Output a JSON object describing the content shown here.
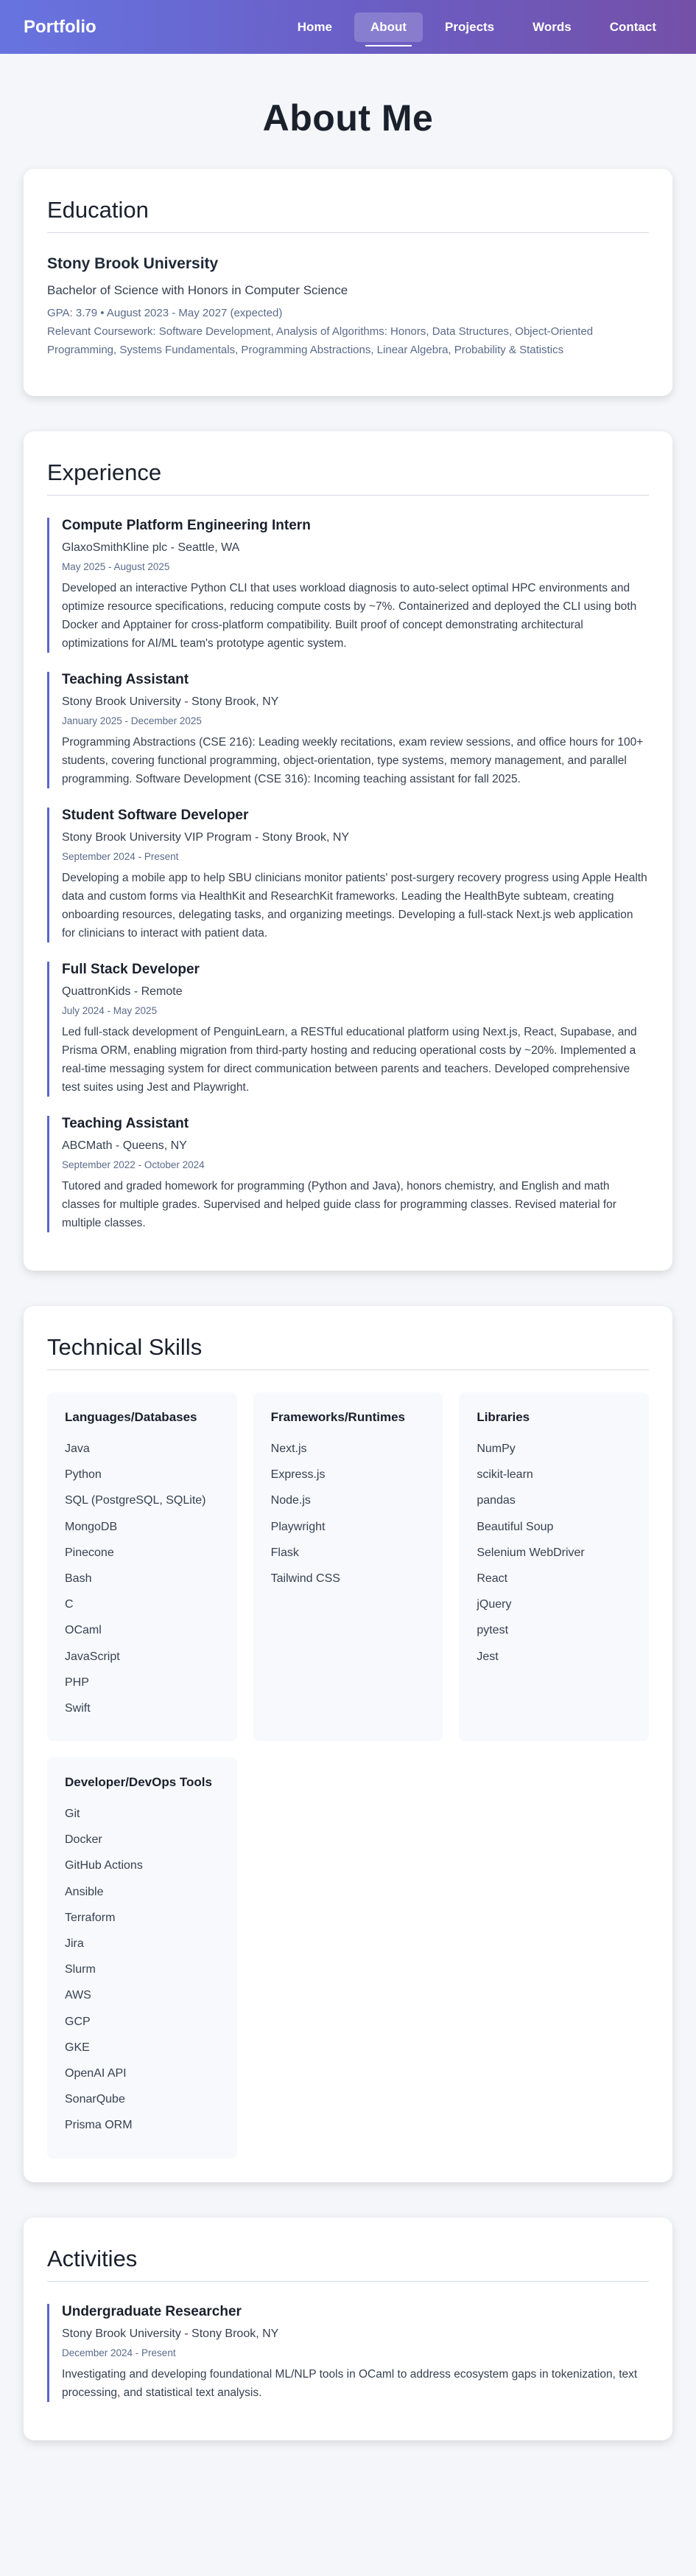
{
  "nav": {
    "brand": "Portfolio",
    "links": [
      "Home",
      "About",
      "Projects",
      "Words",
      "Contact"
    ]
  },
  "page_title": "About Me",
  "education": {
    "title": "Education",
    "school": "Stony Brook University",
    "degree": "Bachelor of Science with Honors in Computer Science",
    "meta": "GPA: 3.79 • August 2023 - May 2027 (expected)",
    "coursework": "Relevant Coursework: Software Development, Analysis of Algorithms: Honors, Data Structures, Object-Oriented Programming, Systems Fundamentals, Programming Abstractions, Linear Algebra, Probability & Statistics"
  },
  "experience": {
    "title": "Experience",
    "entries": [
      {
        "title": "Compute Platform Engineering Intern",
        "org": "GlaxoSmithKline plc - Seattle, WA",
        "date": "May 2025 - August 2025",
        "desc": "Developed an interactive Python CLI that uses workload diagnosis to auto-select optimal HPC environments and optimize resource specifications, reducing compute costs by ~7%. Containerized and deployed the CLI using both Docker and Apptainer for cross-platform compatibility. Built proof of concept demonstrating architectural optimizations for AI/ML team's prototype agentic system."
      },
      {
        "title": "Teaching Assistant",
        "org": "Stony Brook University - Stony Brook, NY",
        "date": "January 2025 - December 2025",
        "desc": "Programming Abstractions (CSE 216): Leading weekly recitations, exam review sessions, and office hours for 100+ students, covering functional programming, object-orientation, type systems, memory management, and parallel programming. Software Development (CSE 316): Incoming teaching assistant for fall 2025."
      },
      {
        "title": "Student Software Developer",
        "org": "Stony Brook University VIP Program - Stony Brook, NY",
        "date": "September 2024 - Present",
        "desc": "Developing a mobile app to help SBU clinicians monitor patients' post-surgery recovery progress using Apple Health data and custom forms via HealthKit and ResearchKit frameworks. Leading the HealthByte subteam, creating onboarding resources, delegating tasks, and organizing meetings. Developing a full-stack Next.js web application for clinicians to interact with patient data."
      },
      {
        "title": "Full Stack Developer",
        "org": "QuattronKids - Remote",
        "date": "July 2024 - May 2025",
        "desc": "Led full-stack development of PenguinLearn, a RESTful educational platform using Next.js, React, Supabase, and Prisma ORM, enabling migration from third-party hosting and reducing operational costs by ~20%. Implemented a real-time messaging system for direct communication between parents and teachers. Developed comprehensive test suites using Jest and Playwright."
      },
      {
        "title": "Teaching Assistant",
        "org": "ABCMath - Queens, NY",
        "date": "September 2022 - October 2024",
        "desc": "Tutored and graded homework for programming (Python and Java), honors chemistry, and English and math classes for multiple grades. Supervised and helped guide class for programming classes. Revised material for multiple classes."
      }
    ]
  },
  "skills": {
    "title": "Technical Skills",
    "groups": [
      {
        "heading": "Languages/Databases",
        "items": [
          "Java",
          "Python",
          "SQL (PostgreSQL, SQLite)",
          "MongoDB",
          "Pinecone",
          "Bash",
          "C",
          "OCaml",
          "JavaScript",
          "PHP",
          "Swift"
        ]
      },
      {
        "heading": "Frameworks/Runtimes",
        "items": [
          "Next.js",
          "Express.js",
          "Node.js",
          "Playwright",
          "Flask",
          "Tailwind CSS"
        ]
      },
      {
        "heading": "Libraries",
        "items": [
          "NumPy",
          "scikit-learn",
          "pandas",
          "Beautiful Soup",
          "Selenium WebDriver",
          "React",
          "jQuery",
          "pytest",
          "Jest"
        ]
      },
      {
        "heading": "Developer/DevOps Tools",
        "items": [
          "Git",
          "Docker",
          "GitHub Actions",
          "Ansible",
          "Terraform",
          "Jira",
          "Slurm",
          "AWS",
          "GCP",
          "GKE",
          "OpenAI API",
          "SonarQube",
          "Prisma ORM"
        ]
      }
    ]
  },
  "activities": {
    "title": "Activities",
    "entries": [
      {
        "title": "Undergraduate Researcher",
        "org": "Stony Brook University - Stony Brook, NY",
        "date": "December 2024 - Present",
        "desc": "Investigating and developing foundational ML/NLP tools in OCaml to address ecosystem gaps in tokenization, text processing, and statistical text analysis."
      }
    ]
  }
}
